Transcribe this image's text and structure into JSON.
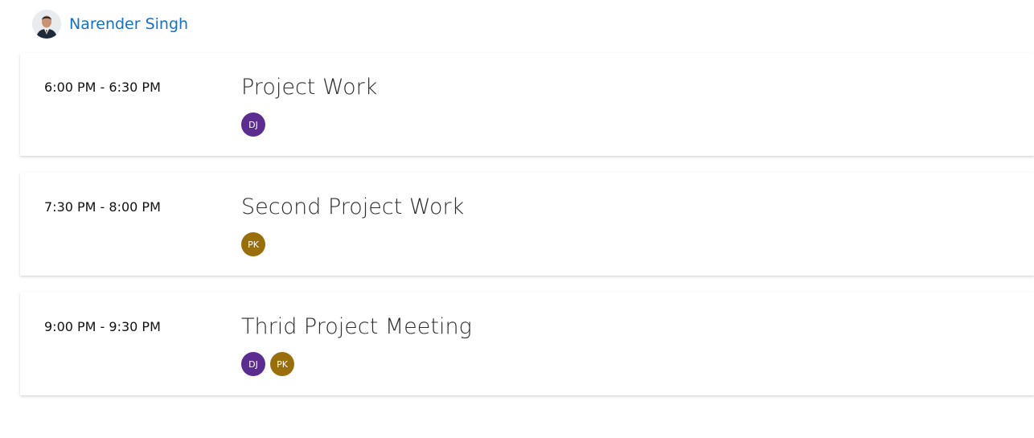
{
  "user": {
    "name": "Narender Singh"
  },
  "colors": {
    "link": "#1470c8",
    "DJ": "#5c2d91",
    "PK": "#986f0b"
  },
  "meetings": [
    {
      "time": "6:00 PM - 6:30 PM",
      "title": "Project Work",
      "attendees": [
        "DJ"
      ]
    },
    {
      "time": "7:30 PM - 8:00 PM",
      "title": "Second Project Work",
      "attendees": [
        "PK"
      ]
    },
    {
      "time": "9:00 PM - 9:30 PM",
      "title": "Thrid Project Meeting",
      "attendees": [
        "DJ",
        "PK"
      ]
    }
  ]
}
